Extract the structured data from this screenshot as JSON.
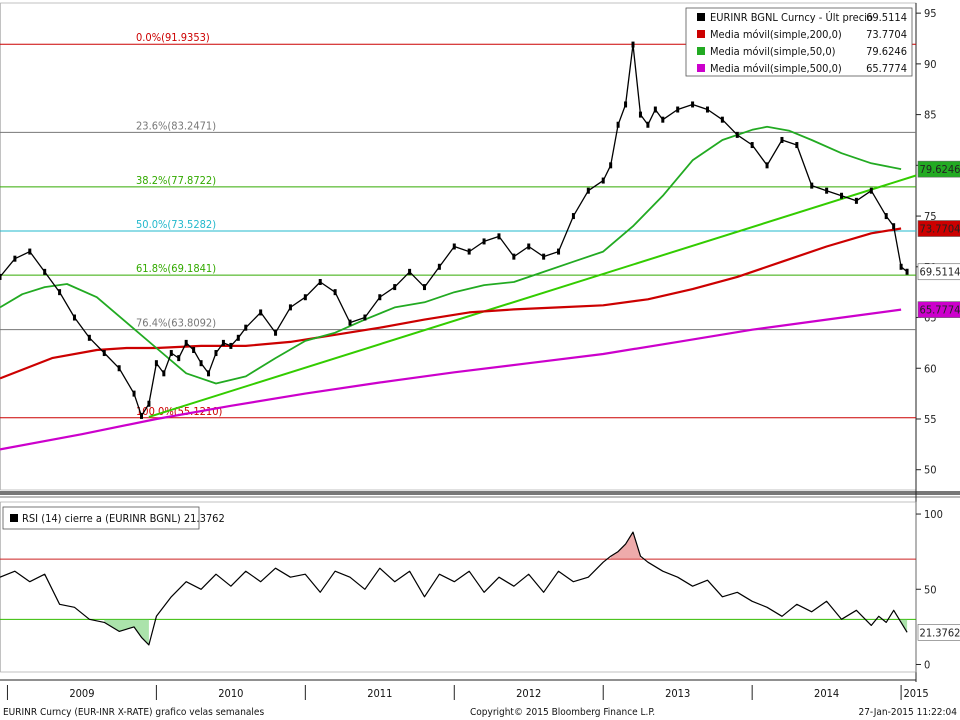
{
  "chart_data": [
    {
      "type": "line",
      "title": "EURINR BGNL Curncy",
      "ylim": [
        48,
        96
      ],
      "y_ticks": [
        50,
        55,
        60,
        65,
        70,
        75,
        80,
        85,
        90,
        95
      ],
      "x_labels": [
        "2009",
        "2010",
        "2011",
        "2012",
        "2013",
        "2014",
        "2015"
      ],
      "x_label_positions_years": [
        2009.0,
        2010.0,
        2011.0,
        2012.0,
        2013.0,
        2014.0,
        2015.0
      ],
      "grid": false,
      "legend_position": "top-right",
      "legend": [
        {
          "label": "EURINR BGNL Curncy - Últ precio",
          "value": "69.5114",
          "color": "#000000"
        },
        {
          "label": "Media móvil(simple,200,0)",
          "value": "73.7704",
          "color": "#cc0000"
        },
        {
          "label": "Media móvil(simple,50,0)",
          "value": "79.6246",
          "color": "#22aa22"
        },
        {
          "label": "Media móvil(simple,500,0)",
          "value": "65.7774",
          "color": "#cc00cc"
        }
      ],
      "fibonacci_levels": [
        {
          "label": "0.0%(91.9353)",
          "value": 91.9353,
          "color": "#cc0000"
        },
        {
          "label": "23.6%(83.2471)",
          "value": 83.2471,
          "color": "#777777"
        },
        {
          "label": "38.2%(77.8722)",
          "value": 77.8722,
          "color": "#33aa00"
        },
        {
          "label": "50.0%(73.5282)",
          "value": 73.5282,
          "color": "#22b8cc"
        },
        {
          "label": "61.8%(69.1841)",
          "value": 69.1841,
          "color": "#33aa00"
        },
        {
          "label": "76.4%(63.8092)",
          "value": 63.8092,
          "color": "#777777"
        },
        {
          "label": "100.0%(55.1210)",
          "value": 55.121,
          "color": "#cc0000"
        }
      ],
      "value_tags": [
        {
          "text": "79.6246",
          "value": 79.6246,
          "color": "#22aa22",
          "fg": "#ffffff"
        },
        {
          "text": "73.7704",
          "value": 73.7704,
          "color": "#cc0000",
          "fg": "#ffffff"
        },
        {
          "text": "69.5114",
          "value": 69.5114,
          "color": "#ffffff",
          "fg": "#000000"
        },
        {
          "text": "65.7774",
          "value": 65.7774,
          "color": "#cc00cc",
          "fg": "#ffffff"
        }
      ],
      "series": [
        {
          "name": "EURINR BGNL Curncy - Últ precio",
          "color": "#000000",
          "x": [
            2008.95,
            2009.05,
            2009.15,
            2009.25,
            2009.35,
            2009.45,
            2009.55,
            2009.65,
            2009.75,
            2009.85,
            2009.9,
            2009.95,
            2010.0,
            2010.05,
            2010.1,
            2010.15,
            2010.2,
            2010.25,
            2010.3,
            2010.35,
            2010.4,
            2010.45,
            2010.5,
            2010.55,
            2010.6,
            2010.7,
            2010.8,
            2010.9,
            2011.0,
            2011.1,
            2011.2,
            2011.3,
            2011.4,
            2011.5,
            2011.6,
            2011.7,
            2011.8,
            2011.9,
            2012.0,
            2012.1,
            2012.2,
            2012.3,
            2012.4,
            2012.5,
            2012.6,
            2012.7,
            2012.8,
            2012.9,
            2013.0,
            2013.05,
            2013.1,
            2013.15,
            2013.2,
            2013.25,
            2013.3,
            2013.35,
            2013.4,
            2013.5,
            2013.6,
            2013.7,
            2013.8,
            2013.9,
            2014.0,
            2014.1,
            2014.2,
            2014.3,
            2014.4,
            2014.5,
            2014.6,
            2014.7,
            2014.8,
            2014.9,
            2014.95,
            2015.0,
            2015.04
          ],
          "values": [
            69.0,
            70.8,
            71.5,
            69.5,
            67.5,
            65.0,
            63.0,
            61.5,
            60.0,
            57.5,
            55.3,
            56.5,
            60.5,
            59.5,
            61.5,
            61.0,
            62.5,
            61.8,
            60.5,
            59.5,
            61.5,
            62.5,
            62.2,
            63.0,
            64.0,
            65.5,
            63.5,
            66.0,
            67.0,
            68.5,
            67.5,
            64.5,
            65.0,
            67.0,
            68.0,
            69.5,
            68.0,
            70.0,
            72.0,
            71.5,
            72.5,
            73.0,
            71.0,
            72.0,
            71.0,
            71.5,
            75.0,
            77.5,
            78.5,
            80.0,
            84.0,
            86.0,
            91.9,
            85.0,
            84.0,
            85.5,
            84.5,
            85.5,
            86.0,
            85.5,
            84.5,
            83.0,
            82.0,
            80.0,
            82.5,
            82.0,
            78.0,
            77.5,
            77.0,
            76.5,
            77.5,
            75.0,
            74.0,
            70.0,
            69.5114
          ]
        },
        {
          "name": "Media móvil(simple,200,0)",
          "color": "#cc0000",
          "x": [
            2008.95,
            2009.3,
            2009.6,
            2009.8,
            2010.0,
            2010.3,
            2010.6,
            2010.9,
            2011.2,
            2011.5,
            2011.8,
            2012.1,
            2012.4,
            2012.7,
            2013.0,
            2013.3,
            2013.6,
            2013.9,
            2014.2,
            2014.5,
            2014.8,
            2015.0
          ],
          "values": [
            59.0,
            61.0,
            61.8,
            62.0,
            62.0,
            62.2,
            62.2,
            62.6,
            63.3,
            64.0,
            64.8,
            65.5,
            65.8,
            66.0,
            66.2,
            66.8,
            67.8,
            69.0,
            70.5,
            72.0,
            73.3,
            73.7704
          ]
        },
        {
          "name": "Media móvil(simple,50,0)",
          "color": "#22aa22",
          "x": [
            2008.95,
            2009.1,
            2009.25,
            2009.4,
            2009.6,
            2009.8,
            2010.0,
            2010.2,
            2010.4,
            2010.6,
            2010.8,
            2011.0,
            2011.2,
            2011.4,
            2011.6,
            2011.8,
            2012.0,
            2012.2,
            2012.4,
            2012.6,
            2012.8,
            2013.0,
            2013.2,
            2013.4,
            2013.6,
            2013.8,
            2014.0,
            2014.1,
            2014.25,
            2014.4,
            2014.6,
            2014.8,
            2015.0
          ],
          "values": [
            66.0,
            67.3,
            68.0,
            68.3,
            67.0,
            64.5,
            62.0,
            59.5,
            58.5,
            59.2,
            61.0,
            62.7,
            63.5,
            64.8,
            66.0,
            66.5,
            67.5,
            68.2,
            68.5,
            69.5,
            70.5,
            71.5,
            74.0,
            77.0,
            80.5,
            82.5,
            83.5,
            83.8,
            83.4,
            82.5,
            81.2,
            80.2,
            79.6246
          ]
        },
        {
          "name": "Media móvil(simple,500,0)",
          "color": "#cc00cc",
          "x": [
            2008.95,
            2009.5,
            2010.0,
            2010.5,
            2011.0,
            2011.5,
            2012.0,
            2012.5,
            2013.0,
            2013.5,
            2014.0,
            2014.5,
            2015.0
          ],
          "values": [
            52.0,
            53.5,
            55.0,
            56.3,
            57.5,
            58.6,
            59.6,
            60.5,
            61.4,
            62.6,
            63.8,
            64.8,
            65.7774
          ]
        },
        {
          "name": "trend",
          "color": "#33cc00",
          "x": [
            2009.95,
            2015.1
          ],
          "values": [
            55.2,
            79.0
          ]
        }
      ]
    },
    {
      "type": "line",
      "title": "RSI (14) cierre a (EURINR BGNL)",
      "legend_value": "21.3762",
      "ylim": [
        -5,
        108
      ],
      "y_ticks": [
        0,
        50,
        100
      ],
      "overbought": 70,
      "oversold": 30,
      "value_tags": [
        {
          "text": "21.3762",
          "value": 21.3762,
          "color": "#ffffff",
          "fg": "#000000"
        }
      ],
      "series": [
        {
          "name": "RSI (14) cierre a (EURINR BGNL)",
          "color": "#000000",
          "x": [
            2008.95,
            2009.05,
            2009.15,
            2009.25,
            2009.35,
            2009.45,
            2009.55,
            2009.65,
            2009.75,
            2009.85,
            2009.9,
            2009.95,
            2010.0,
            2010.1,
            2010.2,
            2010.3,
            2010.4,
            2010.5,
            2010.6,
            2010.7,
            2010.8,
            2010.9,
            2011.0,
            2011.1,
            2011.2,
            2011.3,
            2011.4,
            2011.5,
            2011.6,
            2011.7,
            2011.8,
            2011.9,
            2012.0,
            2012.1,
            2012.2,
            2012.3,
            2012.4,
            2012.5,
            2012.6,
            2012.7,
            2012.8,
            2012.9,
            2013.0,
            2013.05,
            2013.1,
            2013.15,
            2013.2,
            2013.25,
            2013.3,
            2013.4,
            2013.5,
            2013.6,
            2013.7,
            2013.8,
            2013.9,
            2014.0,
            2014.1,
            2014.2,
            2014.3,
            2014.4,
            2014.5,
            2014.6,
            2014.7,
            2014.8,
            2014.85,
            2014.9,
            2014.95,
            2015.0,
            2015.04
          ],
          "values": [
            58,
            62,
            55,
            60,
            40,
            38,
            30,
            28,
            22,
            25,
            18,
            13,
            32,
            45,
            55,
            50,
            60,
            52,
            62,
            55,
            64,
            58,
            60,
            48,
            62,
            58,
            50,
            64,
            55,
            62,
            45,
            60,
            55,
            62,
            48,
            58,
            52,
            60,
            48,
            62,
            55,
            58,
            68,
            72,
            75,
            80,
            88,
            72,
            68,
            62,
            58,
            52,
            56,
            45,
            48,
            42,
            38,
            32,
            40,
            35,
            42,
            30,
            36,
            26,
            32,
            28,
            36,
            28,
            21.3762
          ]
        }
      ]
    }
  ],
  "footer": {
    "left": "EURINR Curncy (EUR-INR X-RATE) grafico velas semanales",
    "center": "Copyright© 2015 Bloomberg Finance L.P.",
    "right": "27-Jan-2015 11:22:04"
  }
}
